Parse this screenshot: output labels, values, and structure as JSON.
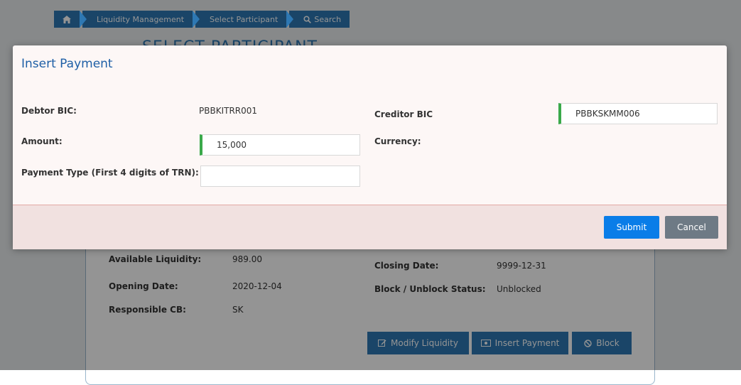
{
  "breadcrumb": {
    "home_icon": "home-icon",
    "items": [
      "Liquidity Management",
      "Select Participant",
      "Search"
    ],
    "search_icon": "search-icon"
  },
  "background": {
    "title": "SELECT PARTICIPANT",
    "available_liquidity_label": "Available Liquidity:",
    "available_liquidity_value": "989.00",
    "opening_date_label": "Opening Date:",
    "opening_date_value": "2020-12-04",
    "responsible_cb_label": "Responsible CB:",
    "responsible_cb_value": "SK",
    "closing_date_label": "Closing Date:",
    "closing_date_value": "9999-12-31",
    "block_status_label": "Block / Unblock Status:",
    "block_status_value": "Unblocked",
    "modify_liquidity_label": "Modify Liquidity",
    "insert_payment_label": "Insert Payment",
    "block_label": "Block"
  },
  "modal": {
    "title": "Insert Payment",
    "debtor_bic_label": "Debtor BIC:",
    "debtor_bic_value": "PBBKITRR001",
    "creditor_bic_label": "Creditor BIC",
    "creditor_bic_value": "PBBKSKMM006",
    "amount_label": "Amount:",
    "amount_value": "15,000",
    "currency_label": "Currency:",
    "payment_type_label": "Payment Type (First 4 digits of TRN):",
    "payment_type_value": "",
    "submit_label": "Submit",
    "cancel_label": "Cancel"
  },
  "colors": {
    "primary": "#2e78b3",
    "submit": "#0a7de8",
    "cancel": "#6e7a85",
    "accent_green": "#3aa94a",
    "title_blue": "#1e5fa6"
  }
}
